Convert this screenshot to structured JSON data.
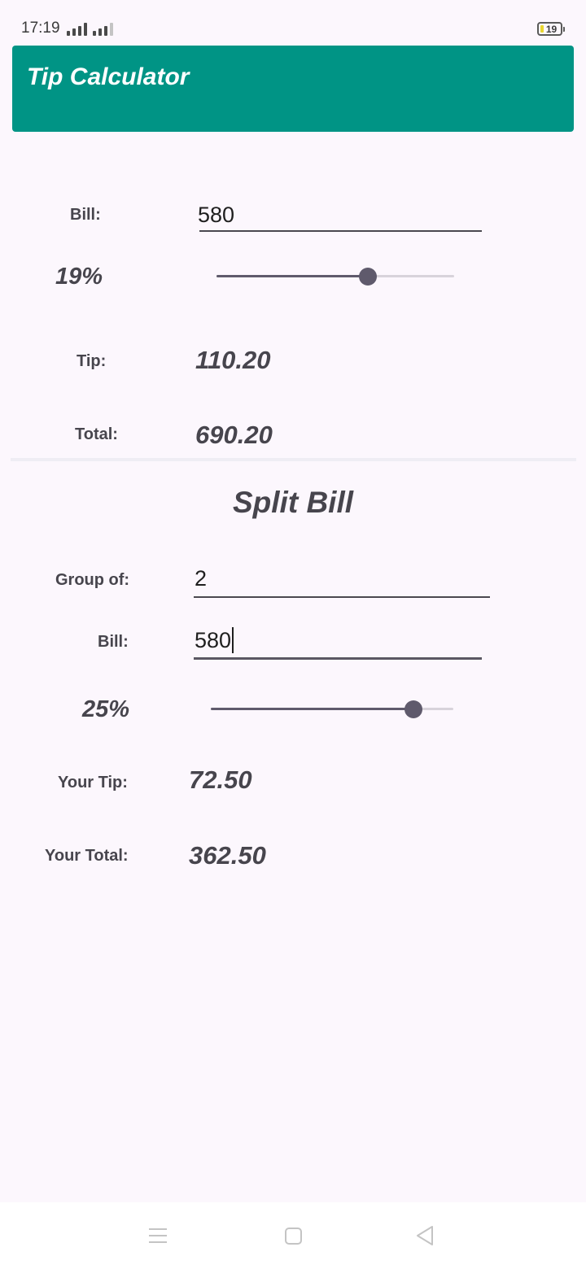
{
  "status_bar": {
    "time": "17:19",
    "battery": "19",
    "icons": [
      "signal-icon",
      "signal-icon",
      "battery-icon"
    ]
  },
  "app_bar": {
    "title": "Tip Calculator",
    "color": "#009485"
  },
  "tip_section": {
    "bill_label": "Bill:",
    "bill_value": "580",
    "tip_percent_label": "19%",
    "slider_value": 0.19,
    "tip_label": "Tip:",
    "tip_value": "110.20",
    "total_label": "Total:",
    "total_value": "690.20"
  },
  "split_section": {
    "title": "Split Bill",
    "group_label": "Group of:",
    "group_value": "2",
    "bill_label": "Bill:",
    "bill_value": "580",
    "tip_percent_label": "25%",
    "slider_value": 0.25,
    "your_tip_label": "Your Tip:",
    "your_tip_value": "72.50",
    "your_total_label": "Your Total:",
    "your_total_value": "362.50"
  },
  "nav_bar": {
    "icons": [
      "menu-icon",
      "home-icon",
      "back-icon"
    ]
  }
}
